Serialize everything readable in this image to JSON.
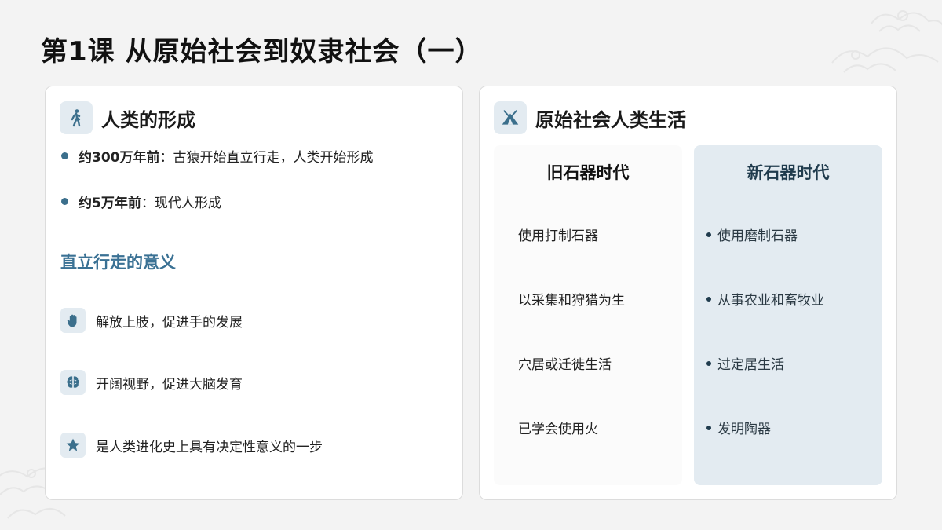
{
  "title": "第1课 从原始社会到奴隶社会（一）",
  "left_card": {
    "icon": "walking-person-icon",
    "title": "人类的形成",
    "facts": [
      {
        "bold": "约300万年前",
        "text": "：古猿开始直立行走，人类开始形成"
      },
      {
        "bold": "约5万年前",
        "text": "：现代人形成"
      }
    ],
    "significance_title": "直立行走的意义",
    "significance": [
      {
        "icon": "hand-icon",
        "text": "解放上肢，促进手的发展"
      },
      {
        "icon": "brain-icon",
        "text": "开阔视野，促进大脑发育"
      },
      {
        "icon": "star-icon",
        "text": "是人类进化史上具有决定性意义的一步"
      }
    ]
  },
  "right_card": {
    "icon": "tent-icon",
    "title": "原始社会人类生活",
    "old_stone_age": {
      "title": "旧石器时代",
      "items": [
        "使用打制石器",
        "以采集和狩猎为生",
        "穴居或迁徙生活",
        "已学会使用火"
      ]
    },
    "new_stone_age": {
      "title": "新石器时代",
      "items": [
        "使用磨制石器",
        "从事农业和畜牧业",
        "过定居生活",
        "发明陶器"
      ]
    }
  },
  "colors": {
    "accent": "#3a7194",
    "icon_bg": "#e3ebf1",
    "icon_fg": "#3b6f8c",
    "new_era_bg": "#e3ebf1"
  }
}
